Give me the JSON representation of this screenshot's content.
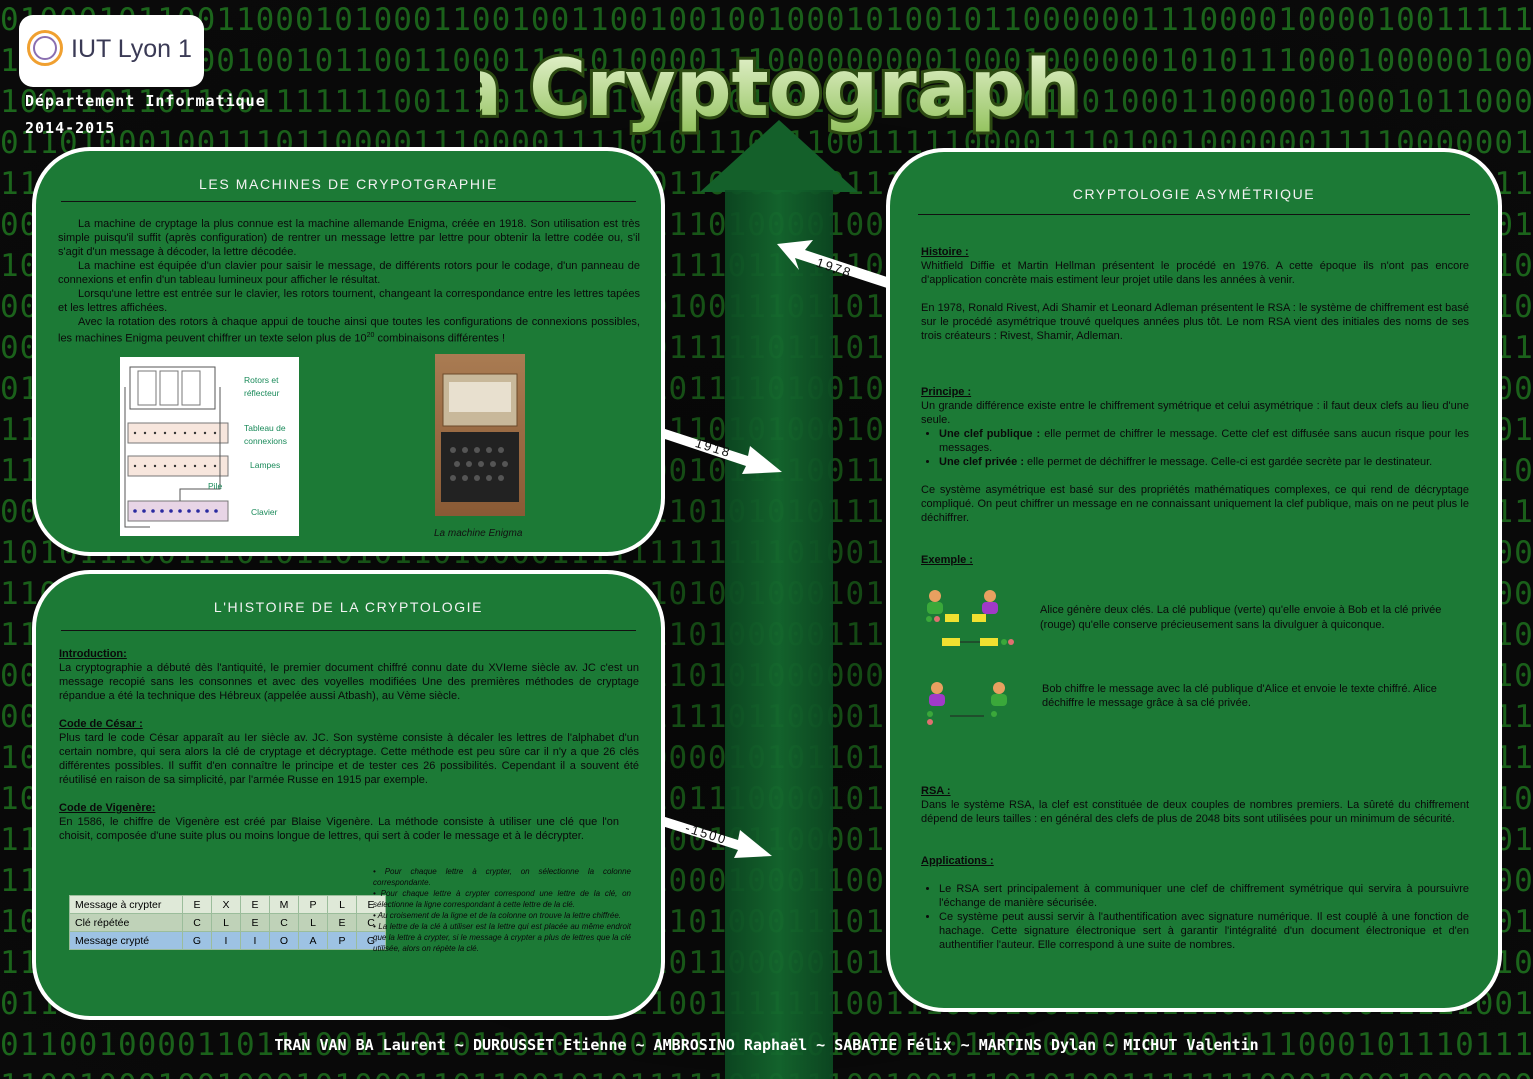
{
  "header": {
    "logo_text": "IUT Lyon 1",
    "department": "Département Informatique",
    "year": "2014-2015",
    "title": "La Cryptographie"
  },
  "timeline": {
    "arrow_1978": "1978",
    "arrow_1918": "1918",
    "arrow_m1500": "-1500"
  },
  "machines": {
    "title": "LES MACHINES DE CRYPOTGRAPHIE",
    "p1": "La machine de cryptage la plus connue est la machine allemande Enigma, créée en 1918. Son utilisation est très simple puisqu'il suffit (après configuration) de rentrer un message lettre par lettre pour obtenir la lettre codée ou, s'il s'agit d'un message à décoder, la lettre décodée.",
    "p2": "La machine est équipée d'un clavier pour saisir le message, de différents rotors pour le codage, d'un panneau de connexions et enfin d'un tableau lumineux pour afficher le résultat.",
    "p3": "Lorsqu'une lettre est entrée sur le clavier, les rotors tournent, changeant la correspondance entre les lettres tapées et les lettres affichées.",
    "p4_a": "Avec la rotation des rotors à chaque appui de touche ainsi que toutes les configurations de connexions possibles, les machines Enigma peuvent chiffrer un texte selon plus de 10",
    "p4_exp": "20",
    "p4_b": " combinaisons différentes !",
    "diagram_labels": {
      "rotors1": "Rotors et",
      "rotors2": "réflecteur",
      "tableau1": "Tableau de",
      "tableau2": "connexions",
      "lampes": "Lampes",
      "pile": "Pile",
      "clavier": "Clavier"
    },
    "caption": "La  machine Enigma"
  },
  "histoire": {
    "title": "L'HISTOIRE DE LA CRYPTOLOGIE",
    "intro_head": "Introduction:",
    "intro_text": "La cryptographie a débuté dès l'antiquité, le premier document chiffré connu date du XVIeme siècle av. JC c'est un message recopié sans les consonnes et avec des voyelles modifiées Une des premières méthodes de cryptage répandue a été la technique des Hébreux (appelée aussi Atbash), au Vème siècle.",
    "cesar_head": "Code de César :",
    "cesar_text": "Plus tard le code César apparaît au Ier siècle av. JC. Son système consiste à décaler les lettres de l'alphabet d'un certain nombre, qui sera alors la clé de cryptage et décryptage. Cette méthode est peu sûre car il n'y a que 26 clés différentes possibles. Il suffit d'en connaître le principe et de tester ces 26 possibilités. Cependant il a souvent été réutilisé en raison de sa simplicité, par l'armée Russe en 1915 par exemple.",
    "vigenere_head": "Code de Vigenère:",
    "vigenere_text": "En 1586, le chiffre de Vigenère est créé par Blaise Vigenère. La méthode consiste à utiliser une clé que l'on choisit, composée d'une suite plus ou moins longue de lettres, qui sert à coder le message et à le décrypter.",
    "table": {
      "rows": [
        {
          "label": "Message à crypter",
          "letters": [
            "E",
            "X",
            "E",
            "M",
            "P",
            "L",
            "E"
          ]
        },
        {
          "label": "Clé répétée",
          "letters": [
            "C",
            "L",
            "E",
            "C",
            "L",
            "E",
            "C"
          ]
        },
        {
          "label": "Message crypté",
          "letters": [
            "G",
            "I",
            "I",
            "O",
            "A",
            "P",
            "G"
          ]
        }
      ]
    },
    "notes": [
      "Pour chaque lettre à crypter, on sélectionne la colonne correspondante.",
      "Pour chaque lettre à crypter correspond une lettre de la clé, on sélectionne la ligne correspondant à cette lettre de la clé.",
      "Au croisement de la ligne et de la colonne on trouve la lettre chiffrée.",
      "La lettre de la clé à utiliser est la lettre qui est placée au même endroit que la lettre à crypter, si le message à crypter a plus de lettres que la clé utilisée, alors on répète la clé."
    ]
  },
  "asym": {
    "title": "CRYPTOLOGIE ASYMÉTRIQUE",
    "histoire_head": "Histoire :",
    "histoire_text1": "Whitfield Diffie et Martin Hellman présentent le procédé en 1976. A cette époque ils n'ont pas encore d'application concrète mais estiment leur projet utile dans les années à venir.",
    "histoire_text2": "En 1978, Ronald Rivest, Adi Shamir et Leonard Adleman présentent le RSA : le système de chiffrement est basé sur le procédé asymétrique trouvé quelques années plus tôt. Le nom RSA vient des initiales des noms de ses trois créateurs : Rivest, Shamir, Adleman.",
    "principe_head": "Principe :",
    "principe_text": "Un grande différence existe entre le chiffrement symétrique et celui asymétrique : il faut deux clefs au lieu d'une seule.",
    "pub_label": "Une clef publique :",
    "pub_text": " elle permet de chiffrer le message. Cette clef est diffusée sans aucun risque pour les messages.",
    "priv_label": "Une clef privée :",
    "priv_text": " elle permet de déchiffrer le message. Celle-ci est gardée secrète par le destinateur.",
    "principe_text2": "Ce système asymétrique est basé sur des propriétés mathématiques complexes, ce qui rend de décryptage compliqué. On peut chiffrer un message en ne connaissant uniquement la clef publique, mais on ne peut plus le déchiffrer.",
    "exemple_head": "Exemple :",
    "exemple1": "Alice génère deux clés. La clé publique (verte) qu'elle envoie à Bob et la clé privée (rouge) qu'elle conserve précieusement sans la divulguer à quiconque.",
    "exemple2": "Bob chiffre le message avec la clé publique d'Alice et envoie le texte chiffré. Alice déchiffre le message grâce à sa clé privée.",
    "rsa_head": "RSA :",
    "rsa_text": "Dans le système RSA, la clef est constituée de deux couples de nombres premiers. La sûreté du chiffrement dépend de leurs tailles : en général des clefs de plus de 2048 bits sont utilisées pour un minimum de sécurité.",
    "app_head": "Applications :",
    "app_items": [
      "Le RSA sert principalement à communiquer une clef de chiffrement symétrique qui servira à poursuivre l'échange de manière sécurisée.",
      "Ce système peut aussi servir à l'authentification avec signature numérique. Il est couplé à une fonction de hachage. Cette signature électronique sert à garantir l'intégralité d'un document électronique et d'en authentifier l'auteur. Elle correspond à une suite de nombres."
    ]
  },
  "footer": "TRAN VAN BA Laurent ~ DUROUSSET Etienne ~ AMBROSINO Raphaël ~ SABATIE Félix ~ MARTINS Dylan ~ MICHUT Valentin",
  "colors": {
    "panel_green": "#1c7a36",
    "binary_green": "#1d6a1d",
    "title_green": "#c9e3a5"
  }
}
